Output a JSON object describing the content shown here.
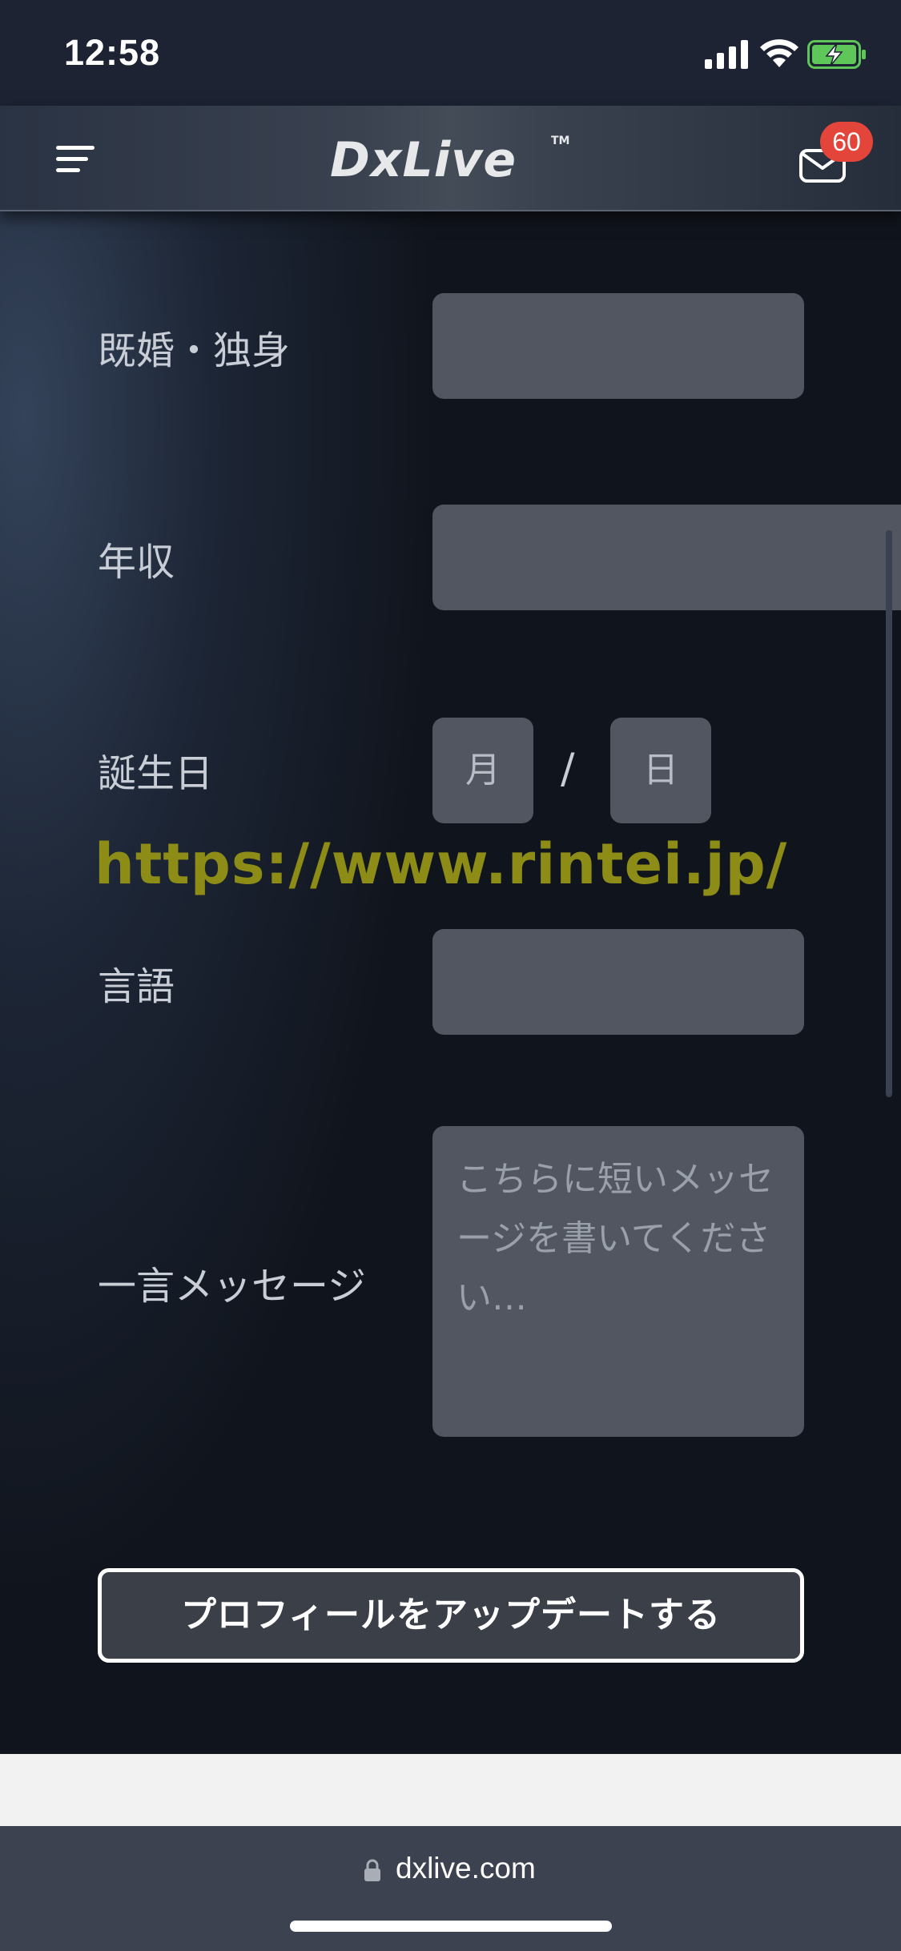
{
  "status_bar": {
    "time": "12:58"
  },
  "header": {
    "logo_text": "DxLive",
    "logo_tm": "TM",
    "mail_badge_count": "60"
  },
  "form": {
    "marital_label": "既婚・独身",
    "income_label": "年収",
    "birthday_label": "誕生日",
    "birthday_month": "月",
    "birthday_separator": "/",
    "birthday_day": "日",
    "language_label": "言語",
    "message_label": "一言メッセージ",
    "message_placeholder": "こちらに短いメッセージを書いてください…",
    "update_button_label": "プロフィールをアップデートする"
  },
  "watermark": {
    "text": "https://www.rintei.jp/",
    "color": "#8c8c17"
  },
  "browser": {
    "url": "dxlive.com"
  },
  "colors": {
    "badge": "#e4453a",
    "field_bg": "#515660",
    "battery_fill": "#5fc75a"
  }
}
